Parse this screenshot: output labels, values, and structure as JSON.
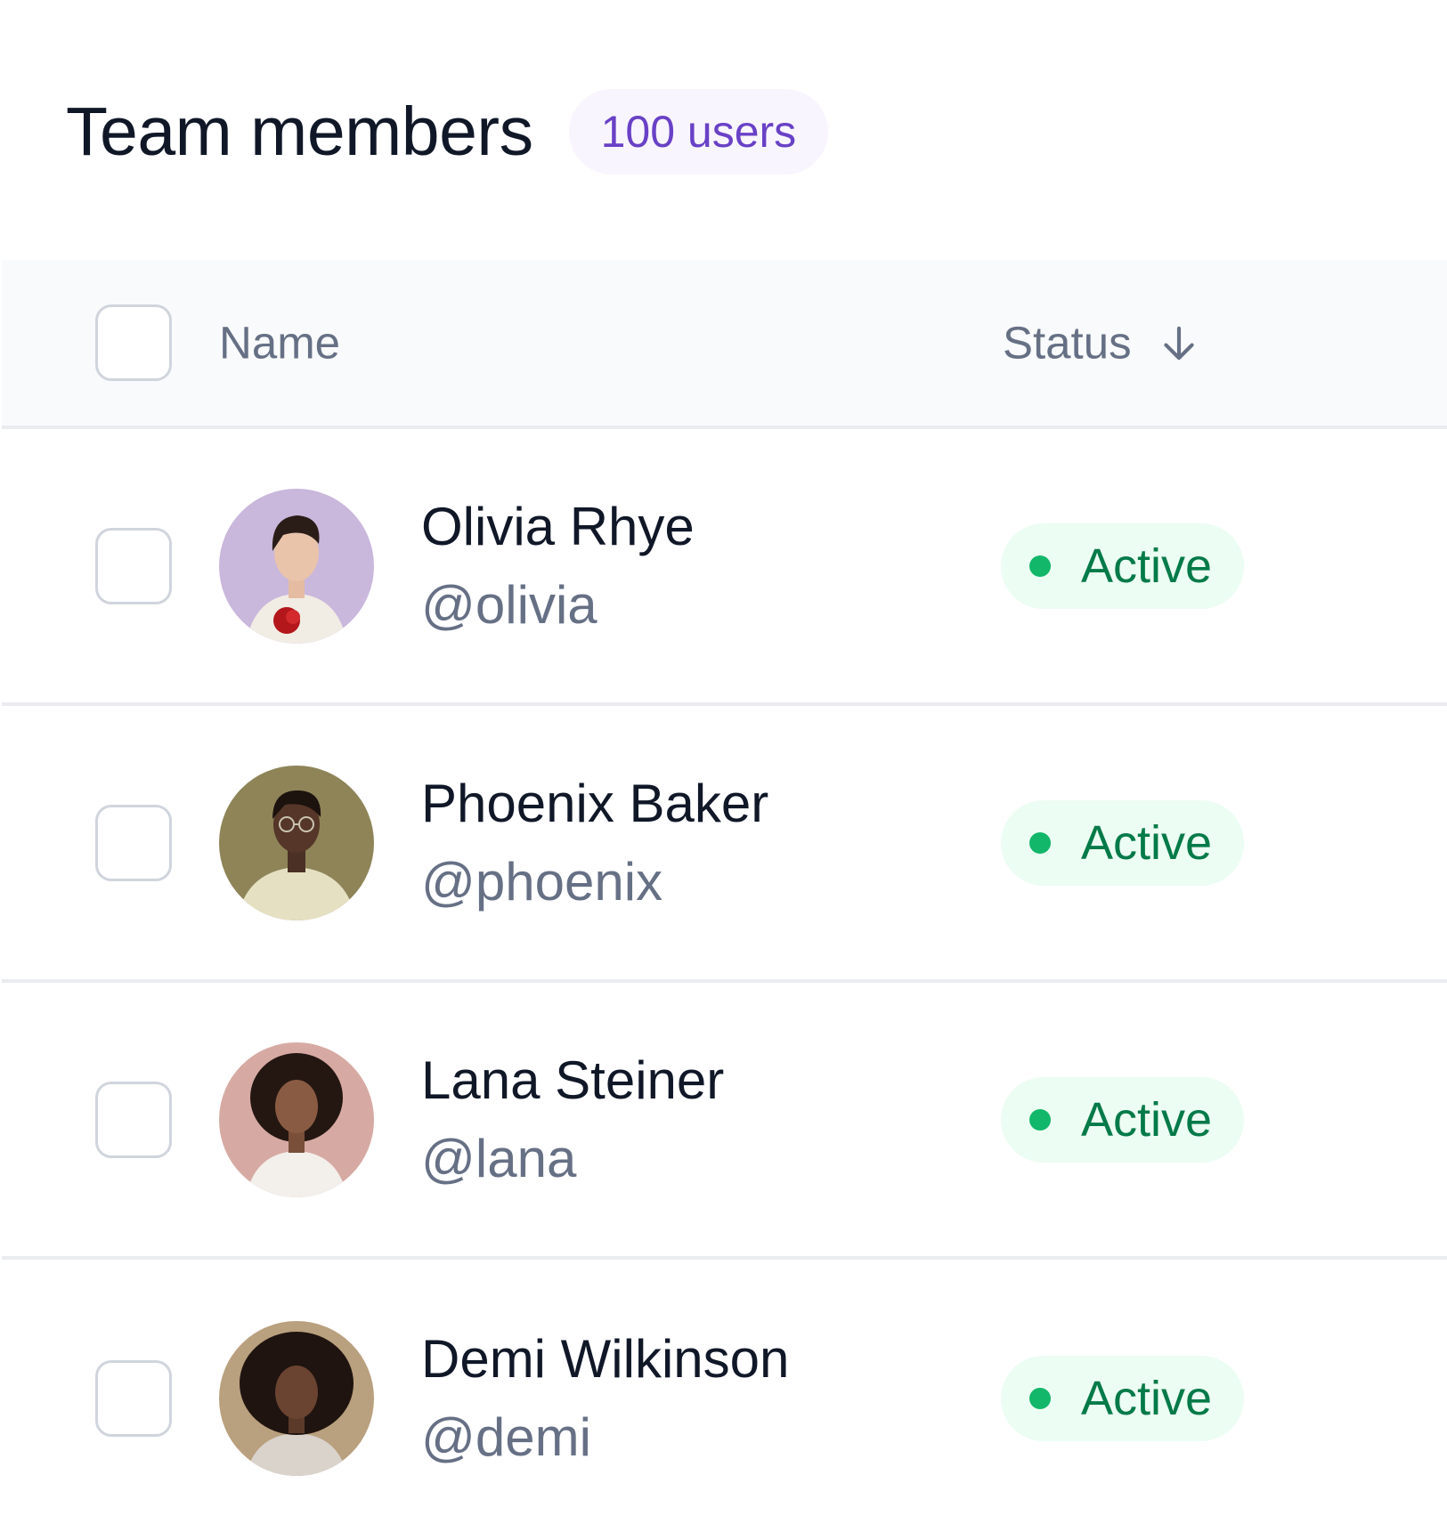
{
  "header": {
    "title": "Team members",
    "count_badge": "100 users"
  },
  "table": {
    "columns": {
      "name": "Name",
      "status": "Status"
    },
    "sort_icon": "arrow-down-icon",
    "rows": [
      {
        "name": "Olivia Rhye",
        "handle": "@olivia",
        "status": "Active",
        "avatar_bg": "#c9b7dc"
      },
      {
        "name": "Phoenix Baker",
        "handle": "@phoenix",
        "status": "Active",
        "avatar_bg": "#8e8458"
      },
      {
        "name": "Lana Steiner",
        "handle": "@lana",
        "status": "Active",
        "avatar_bg": "#d6aaa3"
      },
      {
        "name": "Demi Wilkinson",
        "handle": "@demi",
        "status": "Active",
        "avatar_bg": "#b9a07e"
      }
    ]
  },
  "colors": {
    "title": "#101828",
    "badge_bg": "#f9f5ff",
    "badge_text": "#6941c6",
    "status_bg": "#ecfdf3",
    "status_text": "#027a48",
    "status_dot": "#12b76a"
  }
}
